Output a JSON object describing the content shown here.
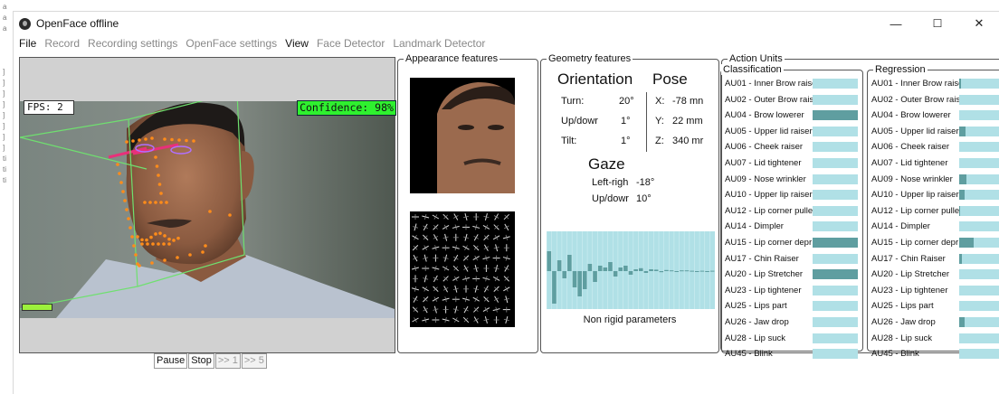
{
  "window": {
    "title": "OpenFace offline",
    "btn_min": "—",
    "btn_max": "☐",
    "btn_close": "✕"
  },
  "menu": [
    {
      "label": "File",
      "enabled": true
    },
    {
      "label": "Record",
      "enabled": false
    },
    {
      "label": "Recording settings",
      "enabled": false
    },
    {
      "label": "OpenFace settings",
      "enabled": false
    },
    {
      "label": "View",
      "enabled": true
    },
    {
      "label": "Face Detector",
      "enabled": false
    },
    {
      "label": "Landmark Detector",
      "enabled": false
    }
  ],
  "video": {
    "fps": "FPS: 2",
    "confidence": "Confidence: 98%",
    "confidence_value": 0.98
  },
  "controls": {
    "pause": "Pause",
    "stop": "Stop",
    "skip1": ">> 1",
    "skip5": ">> 5"
  },
  "appearance": {
    "title": "Appearance features"
  },
  "geometry": {
    "title": "Geometry features",
    "orientation_title": "Orientation",
    "pose_title": "Pose",
    "turn_label": "Turn:",
    "turn_value": "20°",
    "updown_label": "Up/dowr",
    "updown_value": "1°",
    "tilt_label": "Tilt:",
    "tilt_value": "1°",
    "x_label": "X:",
    "x_value": "-78 mn",
    "y_label": "Y:",
    "y_value": "22 mm",
    "z_label": "Z:",
    "z_value": "340 mr",
    "gaze_title": "Gaze",
    "lr_label": "Left-righ",
    "lr_value": "-18°",
    "gud_label": "Up/dowr",
    "gud_value": "10°",
    "nonrigid_title": "Non rigid parameters",
    "nonrigid_values": [
      0.55,
      -0.9,
      0.3,
      -0.2,
      0.45,
      -0.45,
      -0.7,
      -0.5,
      0.2,
      -0.3,
      0.15,
      0.1,
      0.25,
      -0.15,
      0.1,
      0.15,
      -0.1,
      0.05,
      0.08,
      -0.05,
      0.05,
      0.04,
      -0.03,
      0.03,
      0.02,
      -0.02,
      0.02,
      0.02,
      0.01,
      -0.01,
      0.01,
      0.0,
      0.01
    ]
  },
  "action_units": {
    "title": "Action Units",
    "classification_title": "Classification",
    "regression_title": "Regression",
    "classification": [
      {
        "label": "AU01 - Inner Brow raise",
        "value": 0
      },
      {
        "label": "AU02 - Outer Brow rais",
        "value": 0
      },
      {
        "label": "AU04 - Brow lowerer",
        "value": 1
      },
      {
        "label": "AU05 - Upper lid raiser",
        "value": 0
      },
      {
        "label": "AU06 - Cheek raiser",
        "value": 0
      },
      {
        "label": "AU07 - Lid tightener",
        "value": 0
      },
      {
        "label": "AU09 - Nose wrinkler",
        "value": 0
      },
      {
        "label": "AU10 - Upper lip raiser",
        "value": 0
      },
      {
        "label": "AU12 - Lip corner pulle",
        "value": 0
      },
      {
        "label": "AU14 - Dimpler",
        "value": 0
      },
      {
        "label": "AU15 - Lip corner depr",
        "value": 1
      },
      {
        "label": "AU17 - Chin Raiser",
        "value": 0
      },
      {
        "label": "AU20 - Lip Stretcher",
        "value": 1
      },
      {
        "label": "AU23 - Lip tightener",
        "value": 0
      },
      {
        "label": "AU25 - Lips part",
        "value": 0
      },
      {
        "label": "AU26 - Jaw drop",
        "value": 0
      },
      {
        "label": "AU28 - Lip suck",
        "value": 0
      },
      {
        "label": "AU45 - Blink",
        "value": 0
      }
    ],
    "regression": [
      {
        "label": "AU01 - Inner Brow raise",
        "value": 0.03
      },
      {
        "label": "AU02 - Outer Brow rais",
        "value": 0
      },
      {
        "label": "AU04 - Brow lowerer",
        "value": 0
      },
      {
        "label": "AU05 - Upper lid raiser",
        "value": 0.12
      },
      {
        "label": "AU06 - Cheek raiser",
        "value": 0
      },
      {
        "label": "AU07 - Lid tightener",
        "value": 0
      },
      {
        "label": "AU09 - Nose wrinkler",
        "value": 0.14
      },
      {
        "label": "AU10 - Upper lip raiser",
        "value": 0.1
      },
      {
        "label": "AU12 - Lip corner pulle",
        "value": 0.02
      },
      {
        "label": "AU14 - Dimpler",
        "value": 0
      },
      {
        "label": "AU15 - Lip corner depr",
        "value": 0.28
      },
      {
        "label": "AU17 - Chin Raiser",
        "value": 0.05
      },
      {
        "label": "AU20 - Lip Stretcher",
        "value": 0
      },
      {
        "label": "AU23 - Lip tightener",
        "value": 0
      },
      {
        "label": "AU25 - Lips part",
        "value": 0
      },
      {
        "label": "AU26 - Jaw drop",
        "value": 0.1
      },
      {
        "label": "AU28 - Lip suck",
        "value": 0
      },
      {
        "label": "AU45 - Blink",
        "value": 0
      }
    ]
  },
  "leftstrip": [
    "a",
    "a",
    "a",
    "",
    "",
    "",
    "]",
    "]",
    "]",
    "]",
    "]",
    "]",
    "]",
    "]",
    "ti",
    "ti",
    "ti"
  ]
}
